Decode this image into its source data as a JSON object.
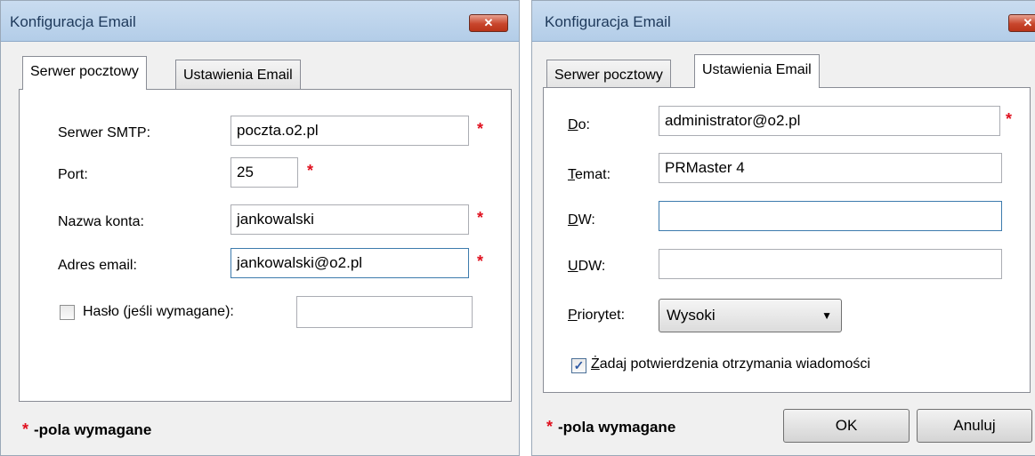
{
  "left_window": {
    "title": "Konfiguracja Email",
    "close_glyph": "✕",
    "tabs": [
      {
        "label": "Serwer pocztowy",
        "active": true
      },
      {
        "label": "Ustawienia Email",
        "active": false
      }
    ],
    "fields": {
      "smtp_label": "Serwer SMTP:",
      "smtp_value": "poczta.o2.pl",
      "port_label": "Port:",
      "port_value": "25",
      "account_label": "Nazwa konta:",
      "account_value": "jankowalski",
      "email_label": "Adres email:",
      "email_value": "jankowalski@o2.pl",
      "password_label": "Hasło (jeśli wymagane):",
      "password_value": ""
    },
    "required_mark": "*",
    "footer": "-pola wymagane"
  },
  "right_window": {
    "title": "Konfiguracja Email",
    "close_glyph": "✕",
    "tabs": [
      {
        "label": "Serwer pocztowy",
        "active": false
      },
      {
        "label": "Ustawienia Email",
        "active": true
      }
    ],
    "fields": {
      "to_label_first": "D",
      "to_label_rest": "o:",
      "to_value": "administrator@o2.pl",
      "subject_label_first": "T",
      "subject_label_rest": "emat:",
      "subject_value": "PRMaster 4",
      "cc_label_first": "D",
      "cc_label_rest": "W:",
      "cc_value": "",
      "bcc_label_first": "U",
      "bcc_label_rest": "DW:",
      "bcc_value": "",
      "priority_label_first": "P",
      "priority_label_rest": "riorytet:",
      "priority_value": "Wysoki",
      "receipt_label_first": "Ż",
      "receipt_label_rest": "adaj potwierdzenia otrzymania wiadomości",
      "receipt_checked": true
    },
    "required_mark": "*",
    "footer": "-pola wymagane",
    "ok_label": "OK",
    "cancel_label": "Anuluj"
  }
}
